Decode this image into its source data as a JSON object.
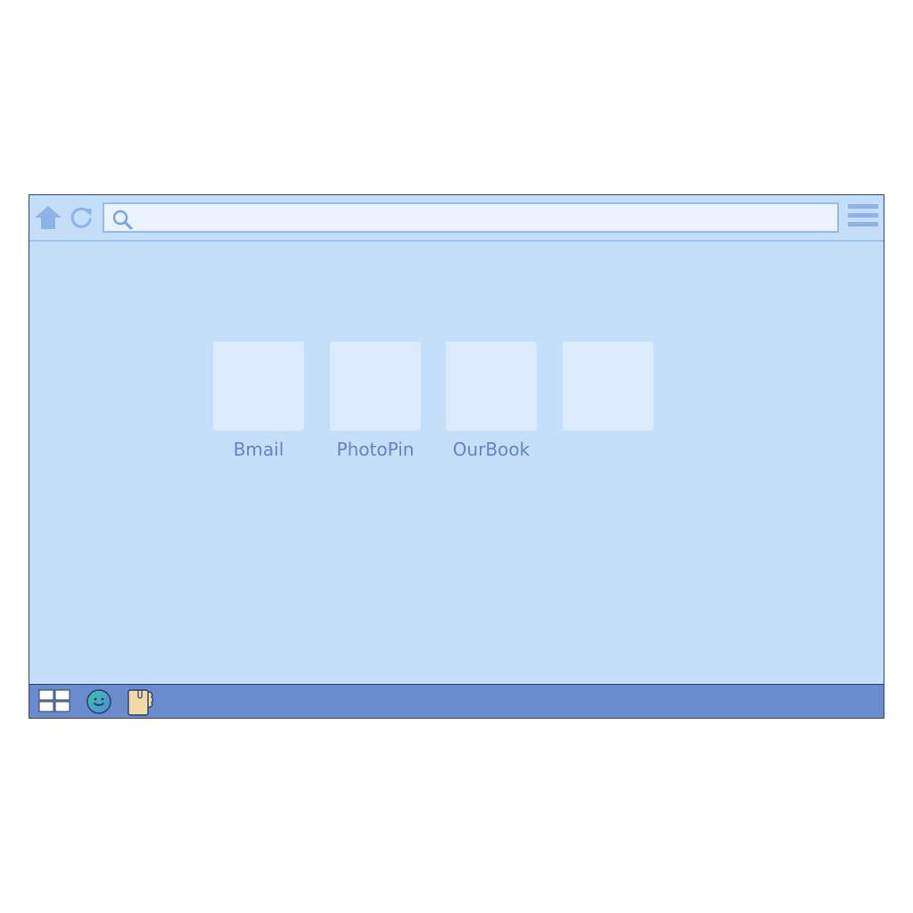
{
  "browser": {
    "address_bar": {
      "value": "",
      "placeholder": ""
    },
    "toolbar": {
      "home_icon": "home-icon",
      "reload_icon": "reload-icon",
      "search_icon": "search-icon",
      "menu_icon": "hamburger-menu-icon"
    }
  },
  "shortcuts": [
    {
      "label": "Bmail"
    },
    {
      "label": "PhotoPin"
    },
    {
      "label": "OurBook"
    },
    {
      "label": ""
    }
  ],
  "taskbar": {
    "items": [
      {
        "icon": "start-grid-icon"
      },
      {
        "icon": "smiley-globe-icon"
      },
      {
        "icon": "document-folder-icon"
      }
    ]
  },
  "colors": {
    "page_bg": "#c5dffb",
    "tile_bg": "#dbeafd",
    "label_text": "#6284c4",
    "taskbar_bg": "#6a8ccf",
    "toolbar_icons": "#8db3e8"
  }
}
